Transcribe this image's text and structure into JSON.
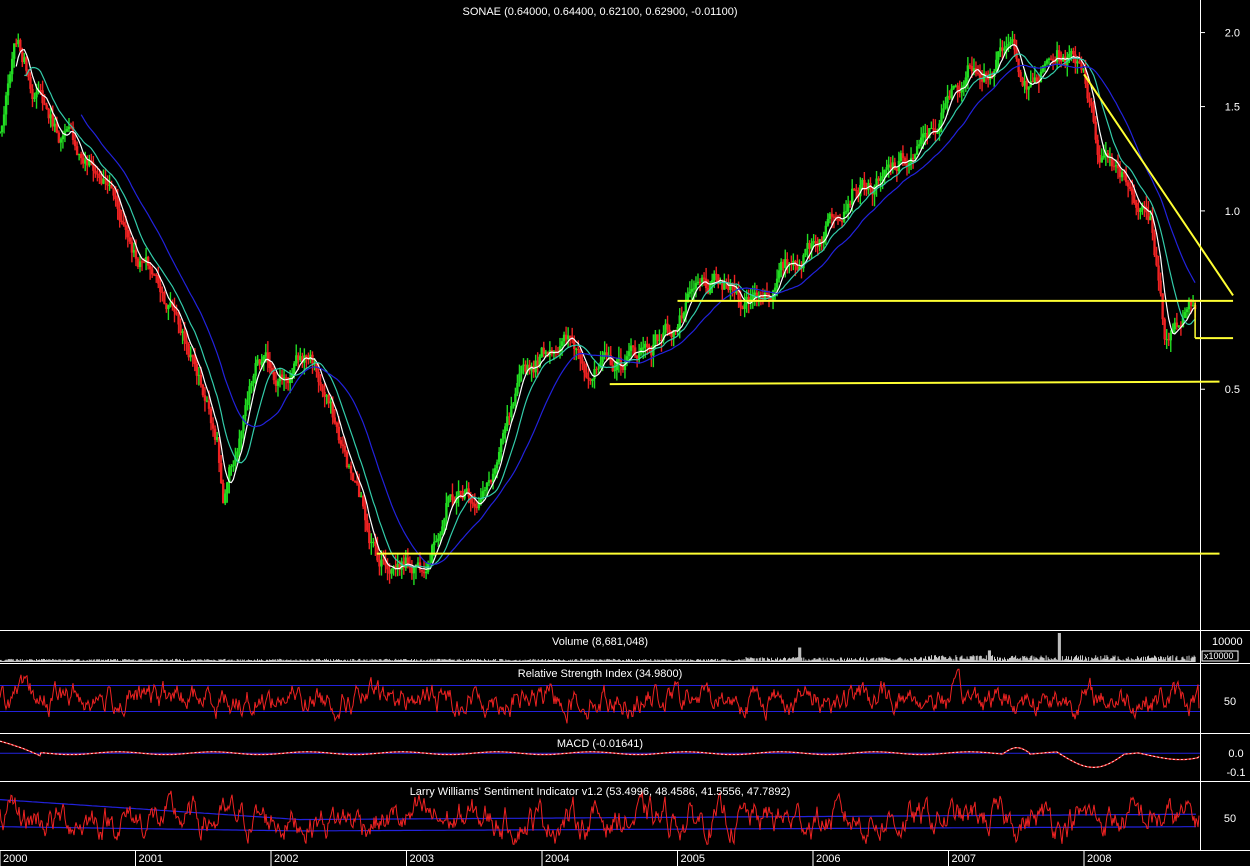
{
  "chart_data": [
    {
      "type": "candlestick",
      "title": "SONAE (0.64000, 0.64400, 0.62100, 0.62900, -0.01100)",
      "scale": "log",
      "ylim": [
        0.2,
        2.1
      ],
      "y_ticks": [
        "2.0",
        "1.5",
        "1.0",
        "0.5"
      ],
      "x_labels": [
        "2000",
        "2001",
        "2002",
        "2003",
        "2004",
        "2005",
        "2006",
        "2007",
        "2008"
      ],
      "colors": {
        "up": "#22dd22",
        "down": "#ee2222",
        "ma_short": "#ffffff",
        "ma_mid": "#33ccaa",
        "ma_long": "#2222dd",
        "trendline": "#ffff33"
      },
      "price_path": [
        {
          "t": 0.0,
          "v": 1.35
        },
        {
          "t": 0.12,
          "v": 1.85
        },
        {
          "t": 0.4,
          "v": 1.4
        },
        {
          "t": 0.8,
          "v": 1.1
        },
        {
          "t": 1.0,
          "v": 0.87
        },
        {
          "t": 1.3,
          "v": 0.68
        },
        {
          "t": 1.6,
          "v": 0.43
        },
        {
          "t": 1.65,
          "v": 0.32
        },
        {
          "t": 1.9,
          "v": 0.53
        },
        {
          "t": 2.1,
          "v": 0.53
        },
        {
          "t": 2.3,
          "v": 0.57
        },
        {
          "t": 2.6,
          "v": 0.35
        },
        {
          "t": 2.8,
          "v": 0.26
        },
        {
          "t": 3.1,
          "v": 0.26
        },
        {
          "t": 3.3,
          "v": 0.33
        },
        {
          "t": 3.6,
          "v": 0.34
        },
        {
          "t": 3.9,
          "v": 0.52
        },
        {
          "t": 4.1,
          "v": 0.62
        },
        {
          "t": 4.5,
          "v": 0.53
        },
        {
          "t": 4.8,
          "v": 0.6
        },
        {
          "t": 5.2,
          "v": 0.72
        },
        {
          "t": 5.5,
          "v": 0.71
        },
        {
          "t": 5.8,
          "v": 0.79
        },
        {
          "t": 6.1,
          "v": 0.96
        },
        {
          "t": 6.3,
          "v": 1.18
        },
        {
          "t": 6.5,
          "v": 1.1
        },
        {
          "t": 6.8,
          "v": 1.25
        },
        {
          "t": 7.0,
          "v": 1.5
        },
        {
          "t": 7.2,
          "v": 1.82
        },
        {
          "t": 7.5,
          "v": 1.85
        },
        {
          "t": 7.6,
          "v": 1.6
        },
        {
          "t": 7.8,
          "v": 1.82
        },
        {
          "t": 8.0,
          "v": 1.78
        },
        {
          "t": 8.1,
          "v": 1.3
        },
        {
          "t": 8.3,
          "v": 1.2
        },
        {
          "t": 8.5,
          "v": 0.95
        },
        {
          "t": 8.6,
          "v": 0.62
        },
        {
          "t": 8.8,
          "v": 0.66
        },
        {
          "t": 9.0,
          "v": 0.63
        }
      ],
      "trendlines": [
        {
          "x1": 2.78,
          "y1": 0.264,
          "x2": 9.0,
          "y2": 0.264
        },
        {
          "x1": 4.5,
          "y1": 0.51,
          "x2": 9.0,
          "y2": 0.515
        },
        {
          "x1": 5.0,
          "y1": 0.705,
          "x2": 9.1,
          "y2": 0.705
        },
        {
          "x1": 8.82,
          "y1": 0.61,
          "x2": 9.1,
          "y2": 0.61
        },
        {
          "x1": 8.0,
          "y1": 1.7,
          "x2": 9.1,
          "y2": 0.72
        }
      ]
    },
    {
      "type": "bar",
      "title": "Volume (8,681,048)",
      "y_ticks": [
        "10000"
      ],
      "unit_label": "x10000",
      "spikes": [
        {
          "t": 5.9,
          "v": 0.5
        },
        {
          "t": 7.3,
          "v": 0.4
        },
        {
          "t": 7.82,
          "v": 1.0
        }
      ]
    },
    {
      "type": "line",
      "title": "Relative Strength Index (34.9800)",
      "y_ticks": [
        "50"
      ],
      "bands": [
        70,
        30
      ],
      "last_value": 34.98
    },
    {
      "type": "line",
      "title": "MACD (-0.01641)",
      "y_ticks": [
        "0.0",
        "-0.1"
      ],
      "last_value": -0.01641
    },
    {
      "type": "line",
      "title": "Larry Williams' Sentiment Indicator v1.2 (53.4996, 48.4586, 41.5556, 47.7892)",
      "y_ticks": [
        "50"
      ],
      "values": [
        53.4996,
        48.4586,
        41.5556,
        47.7892
      ]
    }
  ]
}
